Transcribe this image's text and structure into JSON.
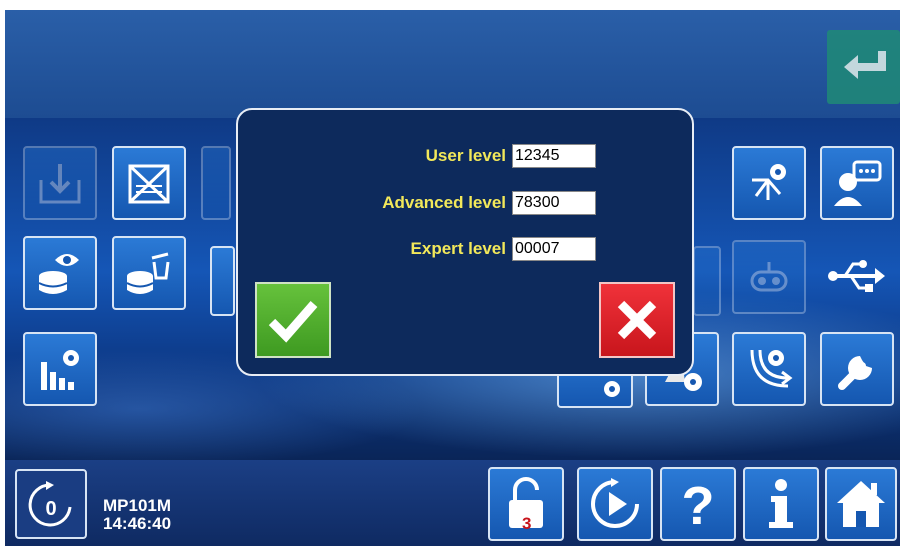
{
  "dialog": {
    "fields": [
      {
        "label": "User level",
        "value": "12345"
      },
      {
        "label": "Advanced level",
        "value": "78300"
      },
      {
        "label": "Expert level",
        "value": "00007"
      }
    ],
    "confirm_icon": "checkmark-icon",
    "cancel_icon": "x-icon"
  },
  "status": {
    "machine": "MP101M",
    "time": "14:46:40"
  },
  "bottom_bar": {
    "lock_badge": "3",
    "buttons": [
      "timer-icon",
      "unlock-icon",
      "play-icon",
      "help-icon",
      "info-icon",
      "home-icon"
    ]
  },
  "colors": {
    "accent_yellow": "#f2e85a",
    "confirm_green": "#4fae2c",
    "cancel_red": "#e0222a",
    "tile_blue": "#1f6cc8"
  }
}
